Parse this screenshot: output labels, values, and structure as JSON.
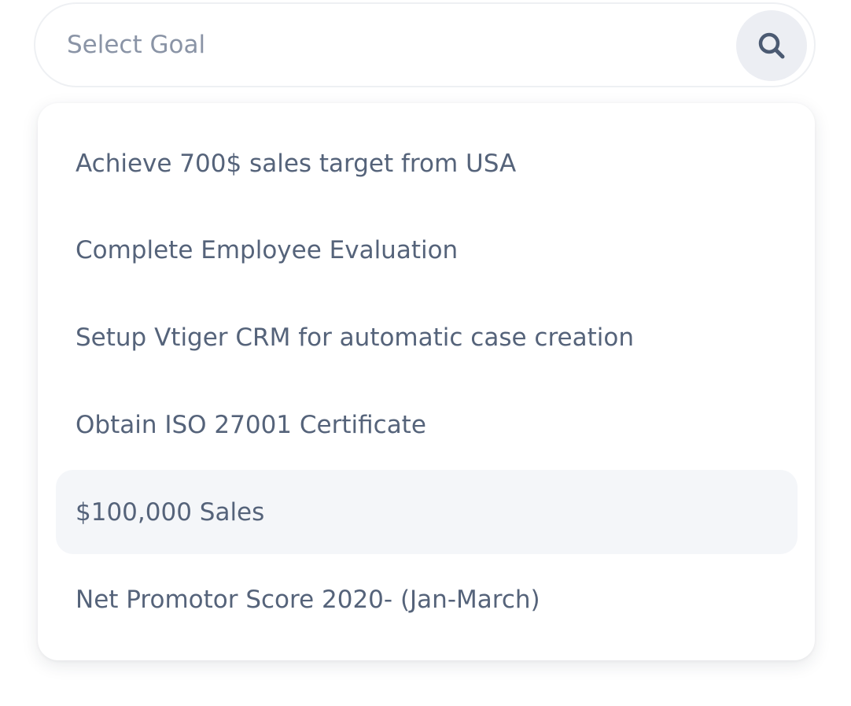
{
  "search": {
    "placeholder": "Select Goal",
    "value": "",
    "button_icon": "search-icon"
  },
  "dropdown": {
    "highlighted_option": "$100,000 Sales",
    "options": [
      "Achieve 700$ sales target from USA",
      "Complete Employee Evaluation",
      "Setup Vtiger CRM for automatic case creation",
      "Obtain ISO 27001 Certificate",
      "$100,000 Sales",
      "Net Promotor Score 2020- (Jan-March)"
    ]
  },
  "colors": {
    "text": "#55637a",
    "placeholder": "#8a94a6",
    "icon": "#4b5a72",
    "highlight": "#f4f6f9",
    "button_bg": "#eceef3"
  }
}
